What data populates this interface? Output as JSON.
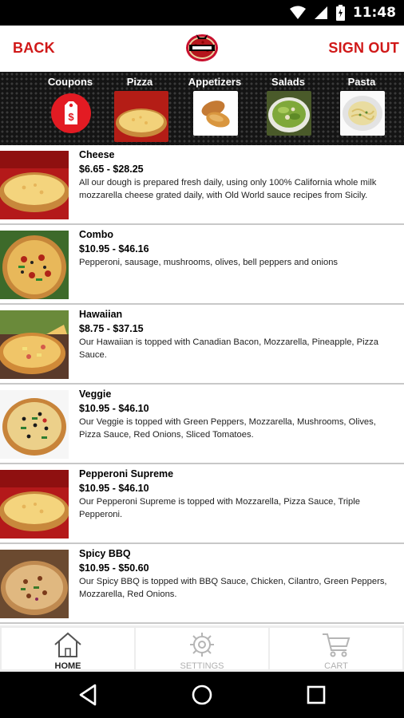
{
  "status_bar": {
    "time": "11:48",
    "icons": [
      "wifi-icon",
      "cell-signal-icon",
      "battery-charging-icon"
    ]
  },
  "header": {
    "back_label": "BACK",
    "signout_label": "SIGN OUT",
    "accent_color": "#d01818",
    "logo": "restaurant-logo"
  },
  "categories": [
    {
      "label": "Coupons",
      "icon": "coupon-tag-icon"
    },
    {
      "label": "Pizza",
      "icon": "pizza-image",
      "selected": true
    },
    {
      "label": "Appetizers",
      "icon": "appetizers-image"
    },
    {
      "label": "Salads",
      "icon": "salad-image"
    },
    {
      "label": "Pasta",
      "icon": "pasta-image"
    }
  ],
  "menu": [
    {
      "name": "Cheese",
      "price": "$6.65 - $28.25",
      "description": "All our dough is prepared fresh daily, using only 100% California whole milk mozzarella cheese grated daily, with Old World sauce recipes from Sicily."
    },
    {
      "name": "Combo",
      "price": "$10.95 - $46.16",
      "description": "Pepperoni, sausage, mushrooms, olives, bell peppers and onions"
    },
    {
      "name": "Hawaiian",
      "price": "$8.75 - $37.15",
      "description": "Our Hawaiian  is topped with Canadian Bacon, Mozzarella, Pineapple, Pizza Sauce."
    },
    {
      "name": "Veggie",
      "price": "$10.95 - $46.10",
      "description": "Our Veggie  is topped with Green Peppers, Mozzarella, Mushrooms, Olives, Pizza Sauce, Red Onions, Sliced Tomatoes."
    },
    {
      "name": "Pepperoni Supreme",
      "price": "$10.95 - $46.10",
      "description": "Our Pepperoni Supreme  is topped with Mozzarella, Pizza Sauce, Triple Pepperoni."
    },
    {
      "name": "Spicy BBQ",
      "price": "$10.95 - $50.60",
      "description": "Our Spicy BBQ  is topped with BBQ Sauce, Chicken, Cilantro, Green Peppers, Mozzarella, Red Onions."
    }
  ],
  "tabs": [
    {
      "label": "HOME",
      "icon": "home-icon",
      "active": true
    },
    {
      "label": "SETTINGS",
      "icon": "gear-icon",
      "active": false
    },
    {
      "label": "CART",
      "icon": "cart-icon",
      "active": false
    }
  ],
  "nav": [
    "back-icon",
    "home-circle-icon",
    "recents-icon"
  ]
}
